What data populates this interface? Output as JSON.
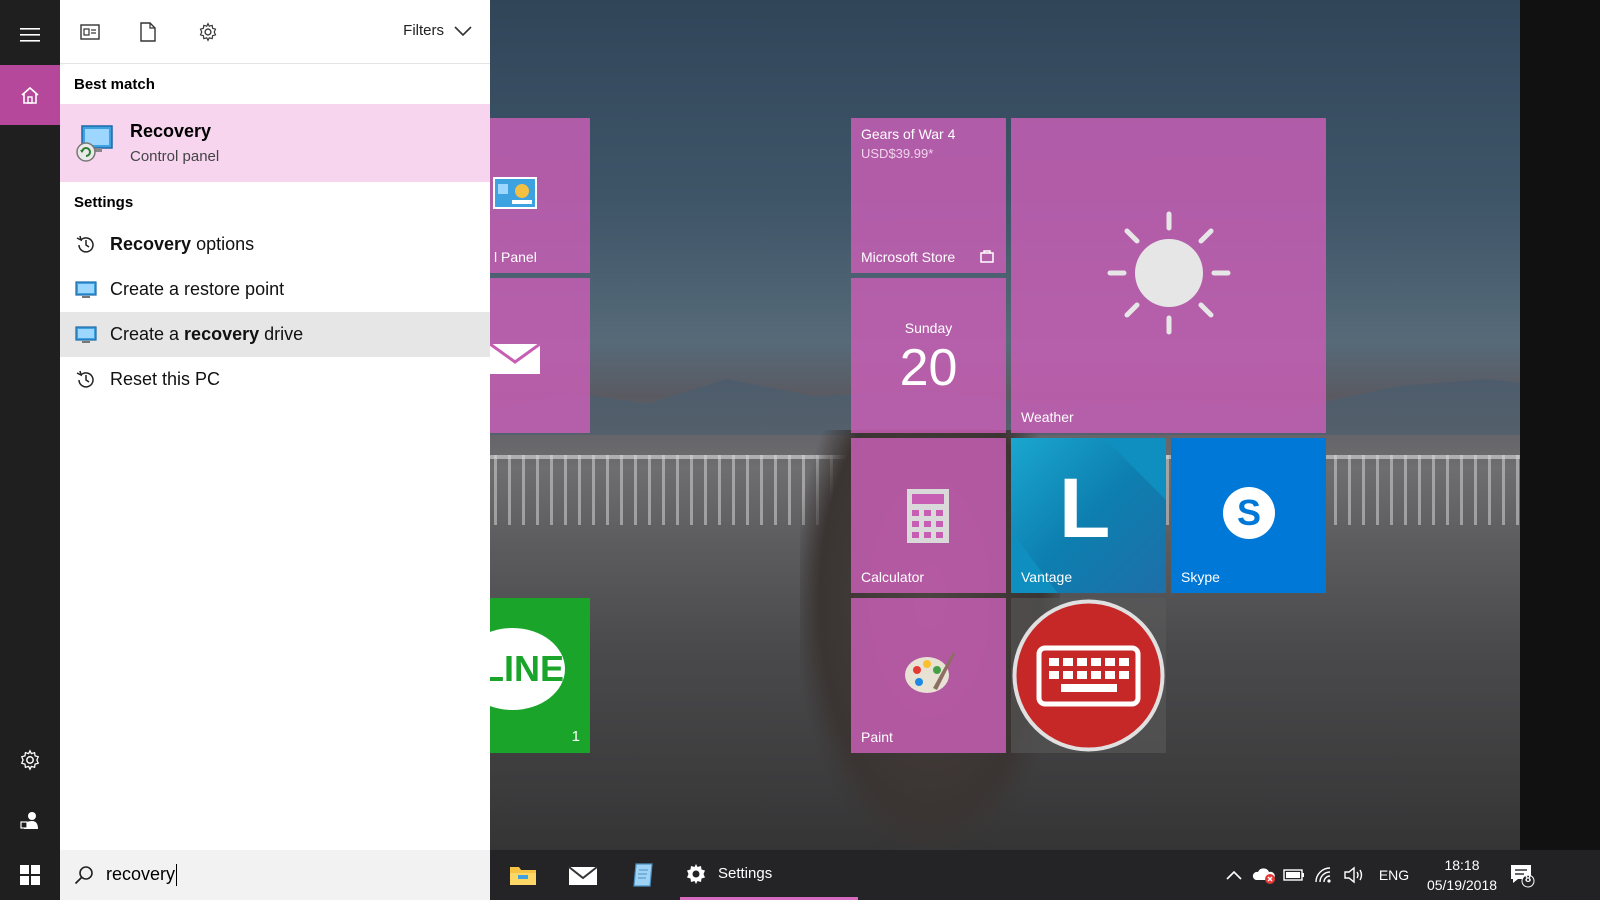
{
  "colors": {
    "accent": "#b5489a",
    "tile": "#c75eb4",
    "best_match_bg": "#f7d5ef",
    "line_green": "#1aa52a",
    "skype_blue": "#0078d7",
    "vantage_teal": "#0e8fbf"
  },
  "rail": {
    "menu_icon": "hamburger-icon",
    "home_icon": "home-icon",
    "settings_icon": "gear-icon",
    "user_icon": "person-icon",
    "start_icon": "windows-logo-icon"
  },
  "panel": {
    "filters_label": "Filters",
    "best_match_heading": "Best match",
    "best_match": {
      "title": "Recovery",
      "subtitle": "Control panel"
    },
    "settings_heading": "Settings",
    "settings_items": [
      {
        "pre": "",
        "bold": "Recovery",
        "post": " options"
      },
      {
        "pre": "Create a restore point",
        "bold": "",
        "post": ""
      },
      {
        "pre": "Create a ",
        "bold": "recovery",
        "post": " drive"
      },
      {
        "pre": "Reset this PC",
        "bold": "",
        "post": ""
      }
    ]
  },
  "search": {
    "value": "recovery"
  },
  "tiles": {
    "control_panel_label": "l Panel",
    "store": {
      "title": "Gears of War 4",
      "price": "USD$39.99*",
      "label": "Microsoft Store"
    },
    "calendar": {
      "day": "Sunday",
      "date": "20"
    },
    "weather_label": "Weather",
    "calculator_label": "Calculator",
    "vantage": {
      "letter": "L",
      "label": "Vantage"
    },
    "skype_label": "Skype",
    "line": {
      "text": "LINE",
      "badge": "1"
    },
    "paint_label": "Paint"
  },
  "taskbar": {
    "settings_label": "Settings",
    "language": "ENG",
    "time": "18:18",
    "date": "05/19/2018",
    "notification_count": "8"
  }
}
